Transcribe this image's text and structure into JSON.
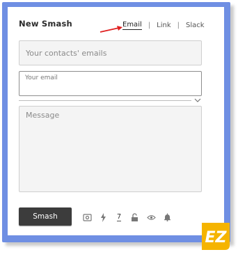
{
  "header": {
    "title": "New Smash",
    "tabs": [
      {
        "label": "Email",
        "active": true
      },
      {
        "label": "Link",
        "active": false
      },
      {
        "label": "Slack",
        "active": false
      }
    ],
    "separator": "|"
  },
  "form": {
    "contacts_placeholder": "Your contacts' emails",
    "your_email_label": "Your email",
    "message_placeholder": "Message"
  },
  "footer": {
    "smash_label": "Smash",
    "expiry_days": "7"
  },
  "colors": {
    "frame": "#6f8fe3",
    "button": "#3c3c3c",
    "arrow": "#e02020",
    "badge_bg": "#f5b400"
  },
  "badge": {
    "text": "EZ"
  }
}
